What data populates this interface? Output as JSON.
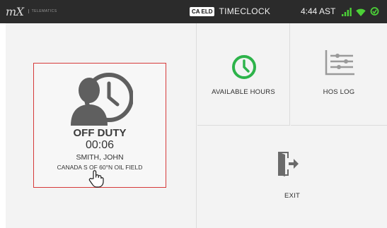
{
  "topbar": {
    "brand_logo": "mX",
    "brand_sub": "TELEMATICS",
    "badge": "CA ELD",
    "title": "TIMECLOCK",
    "time": "4:44 AST"
  },
  "status_card": {
    "duty_status": "OFF DUTY",
    "duty_time": "00:06",
    "driver_name": "SMITH, JOHN",
    "ruleset": "CANADA S OF 60°N OIL FIELD"
  },
  "tiles": {
    "available_hours": "AVAILABLE HOURS",
    "hos_log": "HOS LOG",
    "exit": "EXIT"
  },
  "colors": {
    "topbar_bg": "#2b2b2b",
    "accent_green": "#2db34a",
    "card_border": "#d63a3a",
    "signal_green": "#4cd137"
  },
  "icons": [
    "person-clock-icon",
    "clock-icon",
    "hos-log-icon",
    "exit-door-icon",
    "signal-icon",
    "wifi-icon",
    "sync-icon",
    "hand-cursor-icon"
  ]
}
